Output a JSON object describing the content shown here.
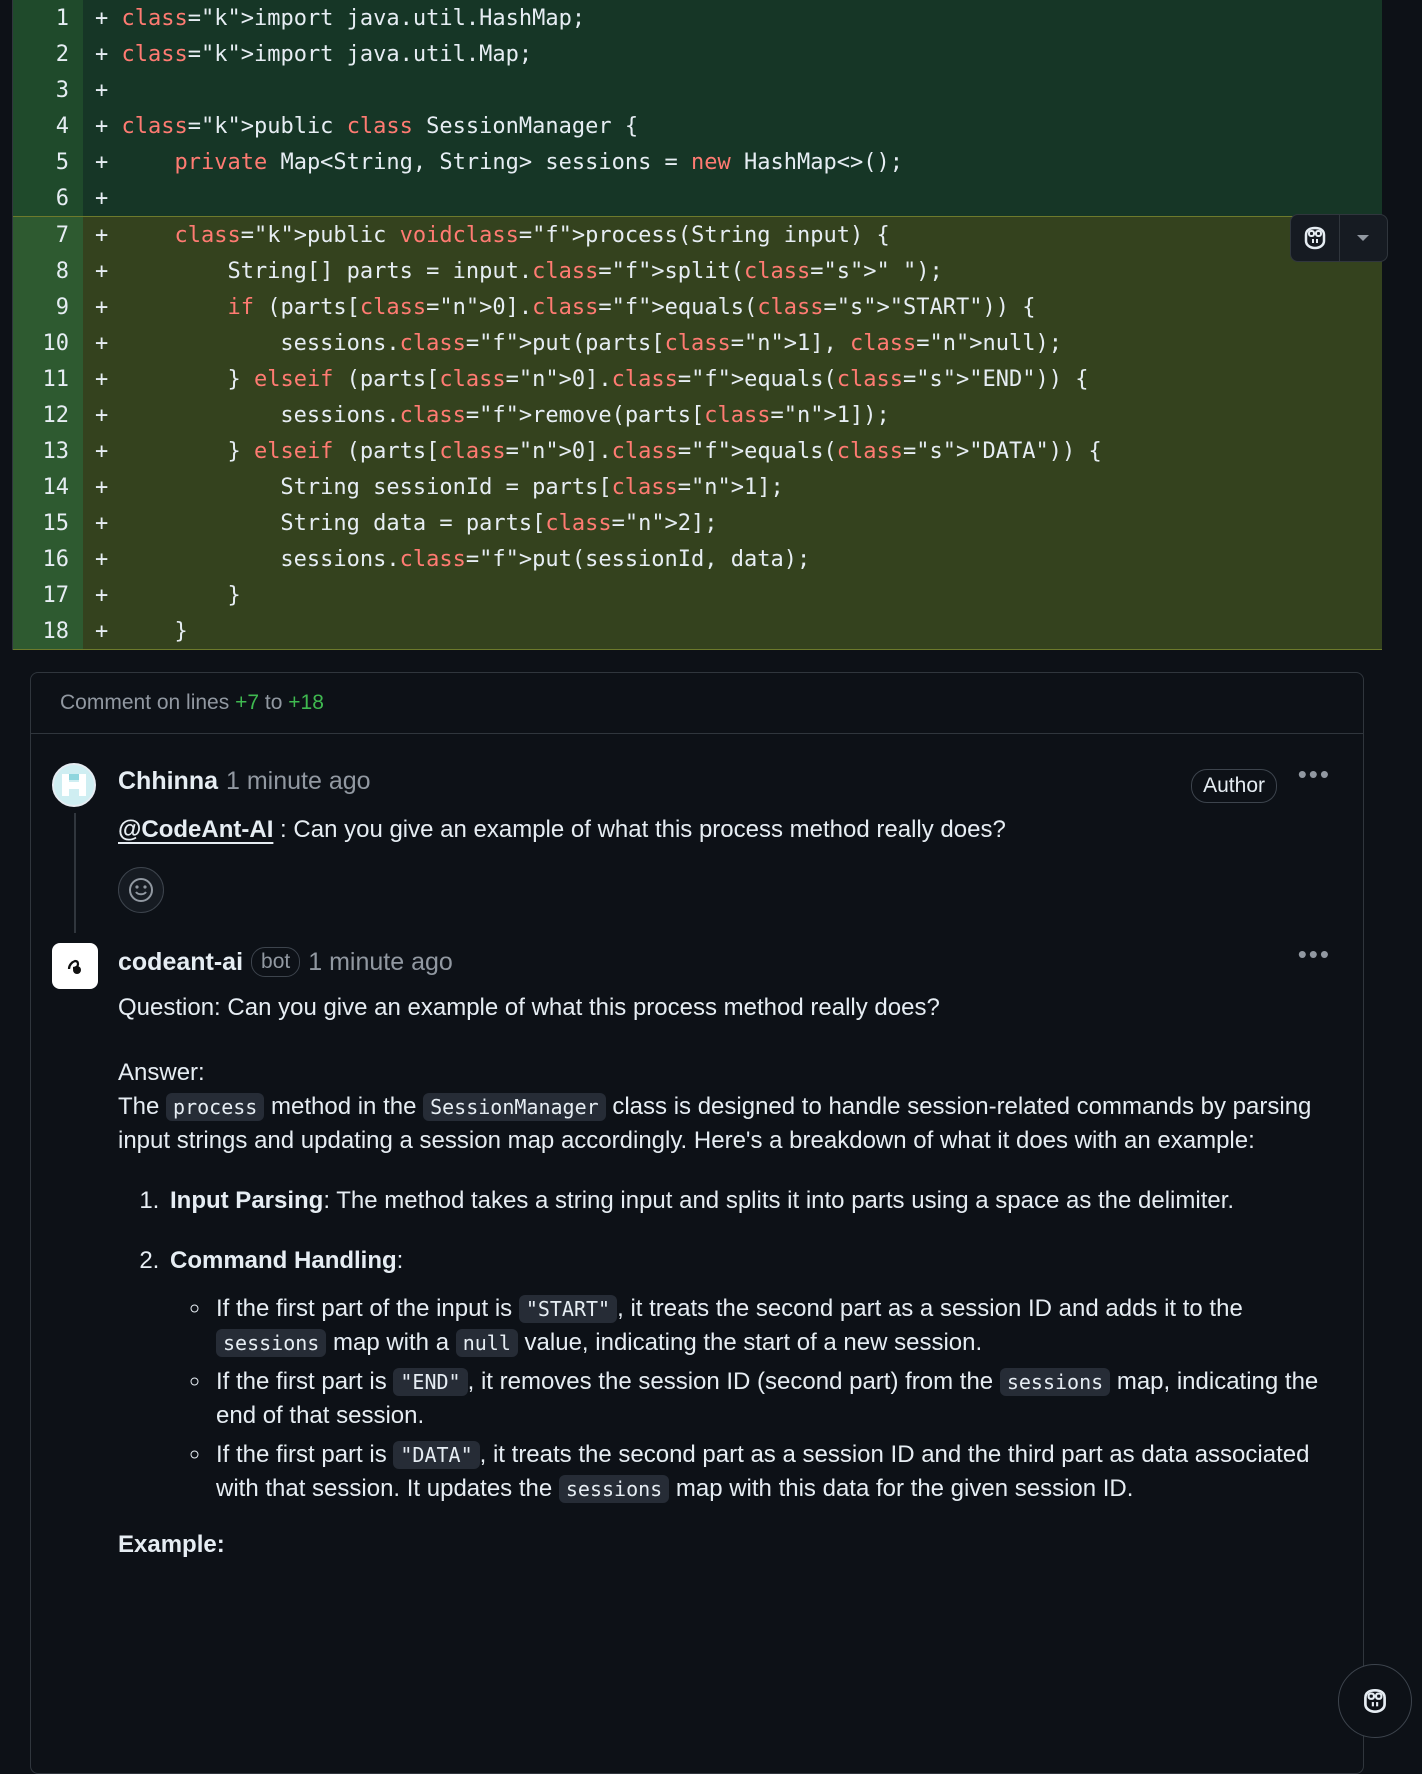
{
  "diff": {
    "lines": [
      {
        "n": "1",
        "code": "+ import java.util.HashMap;"
      },
      {
        "n": "2",
        "code": "+ import java.util.Map;"
      },
      {
        "n": "3",
        "code": "+"
      },
      {
        "n": "4",
        "code": "+ public class SessionManager {"
      },
      {
        "n": "5",
        "code": "+     private Map<String, String> sessions = new HashMap<>();"
      },
      {
        "n": "6",
        "code": "+"
      },
      {
        "n": "7",
        "code": "+     public void process(String input) {"
      },
      {
        "n": "8",
        "code": "+         String[] parts = input.split(\" \");"
      },
      {
        "n": "9",
        "code": "+         if (parts[0].equals(\"START\")) {"
      },
      {
        "n": "10",
        "code": "+             sessions.put(parts[1], null);"
      },
      {
        "n": "11",
        "code": "+         } else if (parts[0].equals(\"END\")) {"
      },
      {
        "n": "12",
        "code": "+             sessions.remove(parts[1]);"
      },
      {
        "n": "13",
        "code": "+         } else if (parts[0].equals(\"DATA\")) {"
      },
      {
        "n": "14",
        "code": "+             String sessionId = parts[1];"
      },
      {
        "n": "15",
        "code": "+             String data = parts[2];"
      },
      {
        "n": "16",
        "code": "+             sessions.put(sessionId, data);"
      },
      {
        "n": "17",
        "code": "+         }"
      },
      {
        "n": "18",
        "code": "+     }"
      }
    ]
  },
  "thread": {
    "header_prefix": "Comment on lines",
    "from": "+7",
    "to_word": "to",
    "to": "+18"
  },
  "comment1": {
    "author": "Chhinna",
    "time": "1 minute ago",
    "badge": "Author",
    "mention": "@CodeAnt-AI",
    "text": " : Can you give an example of what this process method really does?"
  },
  "comment2": {
    "author": "codeant-ai",
    "bot_label": "bot",
    "time": "1 minute ago",
    "question": "Question: Can you give an example of what this process method really does?",
    "answer_label": "Answer:",
    "intro": {
      "t1": "The ",
      "c1": "process",
      "t2": " method in the ",
      "c2": "SessionManager",
      "t3": " class is designed to handle session-related commands by parsing input strings and updating a session map accordingly. Here's a breakdown of what it does with an example:"
    },
    "step1_title": "Input Parsing",
    "step1_text": ": The method takes a string input and splits it into parts using a space as the delimiter.",
    "step2_title": "Command Handling",
    "step2_text": ":",
    "b1": {
      "t1": "If the first part of the input is ",
      "c1": "\"START\"",
      "t2": ", it treats the second part as a session ID and adds it to the ",
      "c2": "sessions",
      "t3": " map with a ",
      "c3": "null",
      "t4": " value, indicating the start of a new session."
    },
    "b2": {
      "t1": "If the first part is ",
      "c1": "\"END\"",
      "t2": ", it removes the session ID (second part) from the ",
      "c2": "sessions",
      "t3": " map, indicating the end of that session."
    },
    "b3": {
      "t1": "If the first part is ",
      "c1": "\"DATA\"",
      "t2": ", it treats the second part as a session ID and the third part as data associated with that session. It updates the ",
      "c2": "sessions",
      "t3": " map with this data for the given session ID."
    },
    "example_label": "Example:"
  },
  "icons": [
    "copilot-icon",
    "chevron-down-icon",
    "smiley-icon",
    "kebab-menu-icon"
  ]
}
